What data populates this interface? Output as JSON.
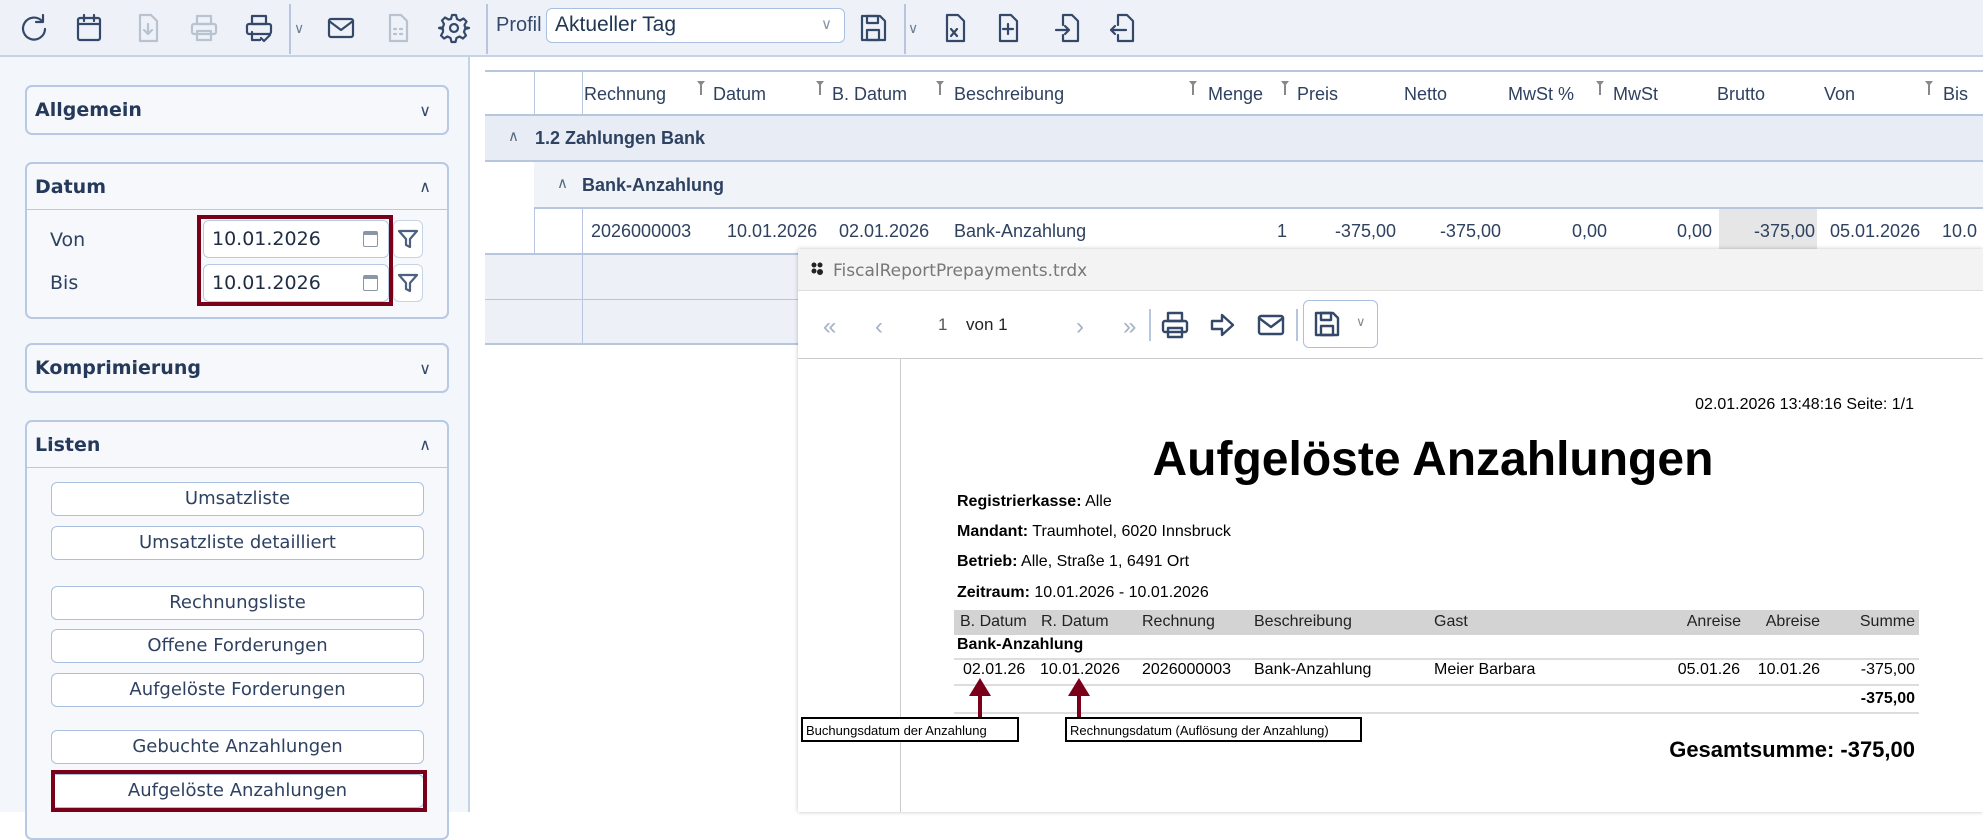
{
  "toolbar": {
    "icons": [
      "refresh-icon",
      "calendar-icon",
      "download-icon",
      "print-icon",
      "print-check-icon",
      "mail-icon",
      "document-calc-icon",
      "gear-icon",
      "save-icon",
      "excel-export-icon",
      "document-add-icon",
      "import-icon",
      "export-icon"
    ],
    "profil_label": "Profil",
    "profil_value": "Aktueller Tag"
  },
  "sidebar": {
    "allgemein": "Allgemein",
    "datum": {
      "title": "Datum",
      "von_label": "Von",
      "von_value": "10.01.2026",
      "bis_label": "Bis",
      "bis_value": "10.01.2026"
    },
    "komprimierung": "Komprimierung",
    "listen": {
      "title": "Listen",
      "buttons": [
        "Umsatzliste",
        "Umsatzliste detailliert",
        "Rechnungsliste",
        "Offene Forderungen",
        "Aufgelöste Forderungen",
        "Gebuchte Anzahlungen",
        "Aufgelöste Anzahlungen"
      ]
    }
  },
  "grid": {
    "columns": [
      "Rechnung",
      "Datum",
      "B. Datum",
      "Beschreibung",
      "Menge",
      "Preis",
      "Netto",
      "MwSt %",
      "MwSt",
      "Brutto",
      "Von",
      "Bis"
    ],
    "group1": "1.2 Zahlungen Bank",
    "group2": "Bank-Anzahlung",
    "row": [
      "2026000003",
      "10.01.2026",
      "02.01.2026",
      "Bank-Anzahlung",
      "1",
      "-375,00",
      "-375,00",
      "0,00",
      "0,00",
      "-375,00",
      "05.01.2026",
      "10.0"
    ]
  },
  "report": {
    "window_title": "FiscalReportPrepayments.trdx",
    "page_current": "1",
    "page_of": "von 1",
    "timestamp": "02.01.2026 13:48:16  Seite: 1/1",
    "title": "Aufgelöste Anzahlungen",
    "info": [
      {
        "k": "Registrierkasse:",
        "v": " Alle"
      },
      {
        "k": "Mandant:",
        "v": " Traumhotel, 6020 Innsbruck"
      },
      {
        "k": "Betrieb:",
        "v": " Alle, Straße 1, 6491 Ort"
      },
      {
        "k": "Zeitraum:",
        "v": " 10.01.2026 - 10.01.2026"
      }
    ],
    "columns": [
      "B. Datum",
      "R. Datum",
      "Rechnung",
      "Beschreibung",
      "Gast",
      "Anreise",
      "Abreise",
      "Summe"
    ],
    "group": "Bank-Anzahlung",
    "row": [
      "02.01.26",
      "10.01.2026",
      "2026000003",
      "Bank-Anzahlung",
      "Meier Barbara",
      "05.01.26",
      "10.01.26",
      "-375,00"
    ],
    "subtotal": "-375,00",
    "total": "Gesamtsumme: -375,00",
    "annotation1": "Buchungsdatum der Anzahlung",
    "annotation2": "Rechnungsdatum (Auflösung der Anzahlung)"
  },
  "colors": {
    "highlight": "#7a0019",
    "accent": "#34496a"
  }
}
